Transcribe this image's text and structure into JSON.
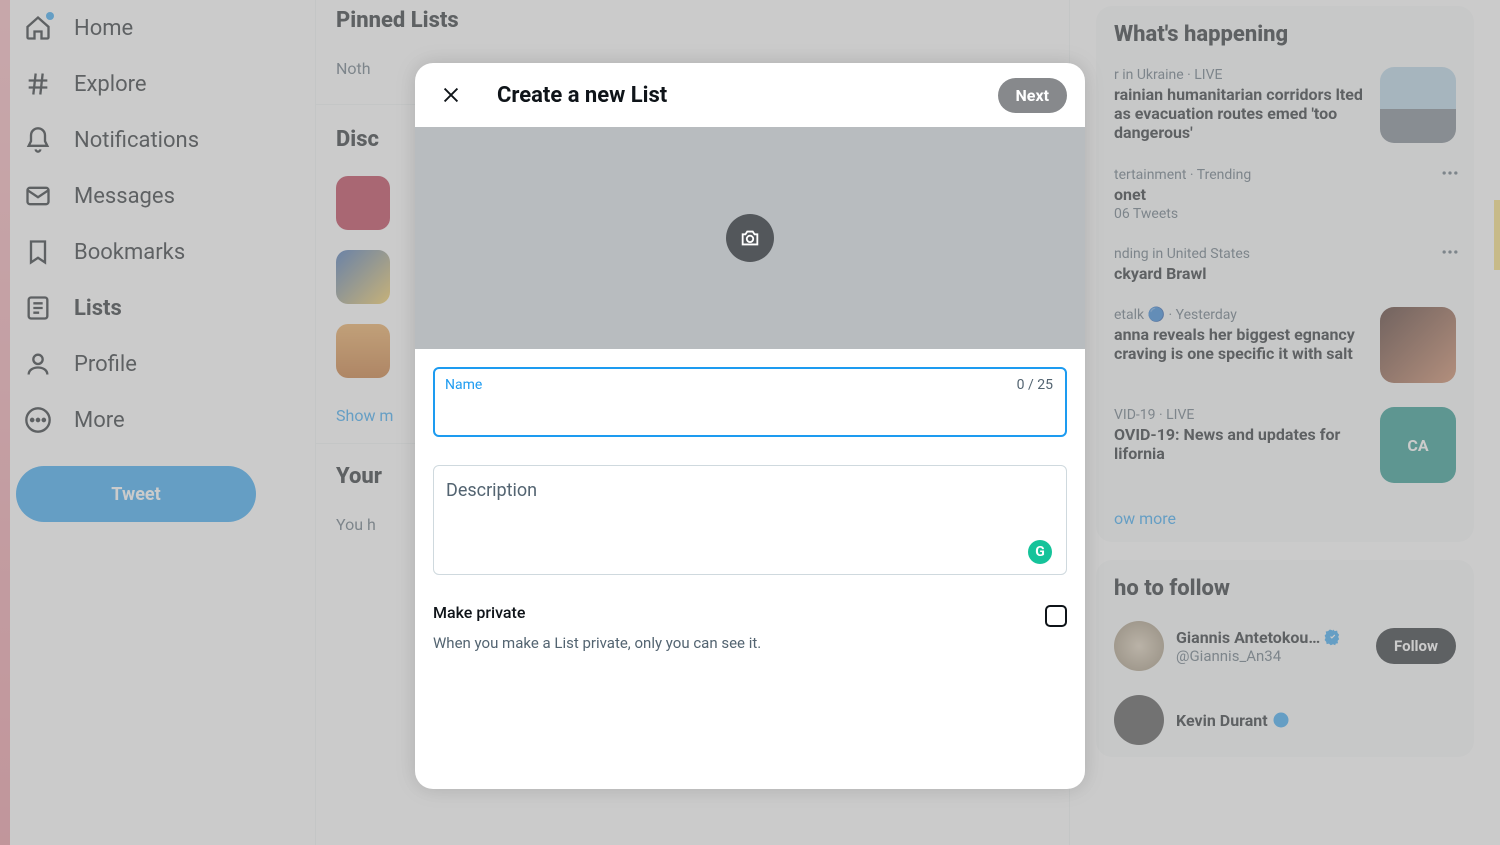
{
  "sidebar": {
    "items": [
      {
        "label": "Home",
        "icon": "home"
      },
      {
        "label": "Explore",
        "icon": "hash"
      },
      {
        "label": "Notifications",
        "icon": "bell"
      },
      {
        "label": "Messages",
        "icon": "mail"
      },
      {
        "label": "Bookmarks",
        "icon": "bookmark"
      },
      {
        "label": "Lists",
        "icon": "list"
      },
      {
        "label": "Profile",
        "icon": "person"
      },
      {
        "label": "More",
        "icon": "more"
      }
    ],
    "tweet_label": "Tweet"
  },
  "main": {
    "pinned_title": "Pinned Lists",
    "pinned_empty": "Noth",
    "discover_title": "Disc",
    "show_more": "Show m",
    "your_lists_title": "Your",
    "your_lists_empty": "You h"
  },
  "modal": {
    "title": "Create a new List",
    "next_label": "Next",
    "name_label": "Name",
    "name_counter": "0 / 25",
    "name_value": "",
    "desc_label": "Description",
    "desc_value": "",
    "private_title": "Make private",
    "private_sub": "When you make a List private, only you can see it.",
    "grammarly_badge": "G"
  },
  "right": {
    "happening_title": "What's happening",
    "trends": [
      {
        "meta": "r in Ukraine · LIVE",
        "title": "rainian humanitarian corridors lted as evacuation routes emed 'too dangerous'",
        "thumb": true
      },
      {
        "meta": "tertainment · Trending",
        "title": "onet",
        "sub": "06 Tweets",
        "more": true
      },
      {
        "meta": "nding in United States",
        "title": "ckyard Brawl",
        "more": true
      },
      {
        "meta": "etalk 🔵 · Yesterday",
        "title": "anna reveals her biggest egnancy craving is one specific it with salt",
        "thumb": true
      },
      {
        "meta": "VID-19 · LIVE",
        "title": "OVID-19: News and updates for lifornia",
        "thumb": true,
        "thumb_label": "CA"
      }
    ],
    "happening_show_more": "ow more",
    "follow_title": "ho to follow",
    "follow_items": [
      {
        "name": "Giannis Antetokou…",
        "handle": "@Giannis_An34",
        "verified": true,
        "follow_label": "Follow"
      },
      {
        "name": "Kevin Durant",
        "handle": "",
        "verified": true
      }
    ]
  }
}
